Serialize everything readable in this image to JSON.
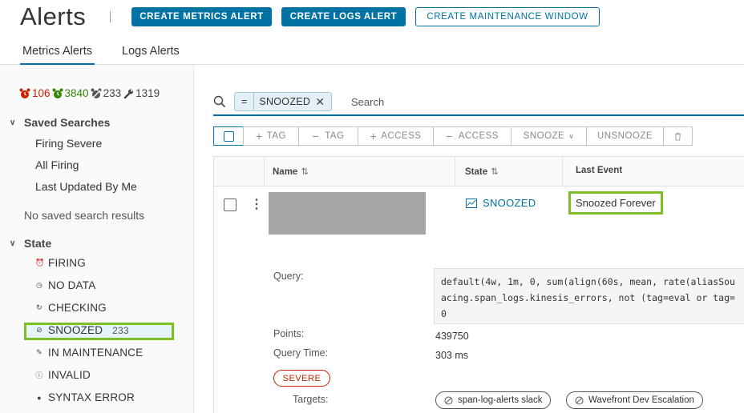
{
  "header": {
    "title": "Alerts",
    "buttons": {
      "create_metrics_alert": "CREATE METRICS ALERT",
      "create_logs_alert": "CREATE LOGS ALERT",
      "create_maintenance_window": "CREATE MAINTENANCE WINDOW"
    }
  },
  "tabs": [
    {
      "label": "Metrics Alerts",
      "active": true
    },
    {
      "label": "Logs Alerts",
      "active": false
    }
  ],
  "sidebar": {
    "counts": {
      "firing": "106",
      "checking": "3840",
      "snoozed": "233",
      "maintenance": "1319",
      "firing_color": "#c92100",
      "checking_color": "#318700"
    },
    "saved_searches": {
      "title": "Saved Searches",
      "items": [
        "Firing Severe",
        "All Firing",
        "Last Updated By Me"
      ],
      "no_results": "No saved search results"
    },
    "state": {
      "title": "State",
      "items": [
        {
          "label": "FIRING",
          "icon": "alarm-icon"
        },
        {
          "label": "NO DATA",
          "icon": "alarm-outline-icon"
        },
        {
          "label": "CHECKING",
          "icon": "sync-icon"
        },
        {
          "label": "SNOOZED",
          "icon": "snooze-icon",
          "count": "233",
          "selected": true
        },
        {
          "label": "IN MAINTENANCE",
          "icon": "wrench-icon"
        },
        {
          "label": "INVALID",
          "icon": "info-icon"
        },
        {
          "label": "SYNTAX ERROR",
          "icon": "error-icon"
        }
      ]
    }
  },
  "search": {
    "filter_operator": "=",
    "filter_value": "SNOOZED",
    "placeholder": "Search"
  },
  "toolbar": {
    "add_tag": "TAG",
    "remove_tag": "TAG",
    "add_access": "ACCESS",
    "remove_access": "ACCESS",
    "snooze": "SNOOZE",
    "unsnooze": "UNSNOOZE"
  },
  "table": {
    "columns": {
      "name": "Name",
      "state": "State",
      "last_event": "Last Event"
    },
    "row": {
      "state": "SNOOZED",
      "last_event": "Snoozed Forever",
      "details": {
        "query_label": "Query:",
        "query_lines": [
          "default(4w, 1m, 0, sum(align(60s, mean, rate(aliasSou",
          "acing.span_logs.kinesis_errors, not (tag=eval or tag=",
          "0"
        ],
        "points_label": "Points:",
        "points_value": "439750",
        "query_time_label": "Query Time:",
        "query_time_value": "303 ms",
        "severity": "SEVERE",
        "targets_label": "Targets:",
        "targets": [
          "span-log-alerts slack",
          "Wavefront Dev Escalation"
        ]
      }
    }
  }
}
